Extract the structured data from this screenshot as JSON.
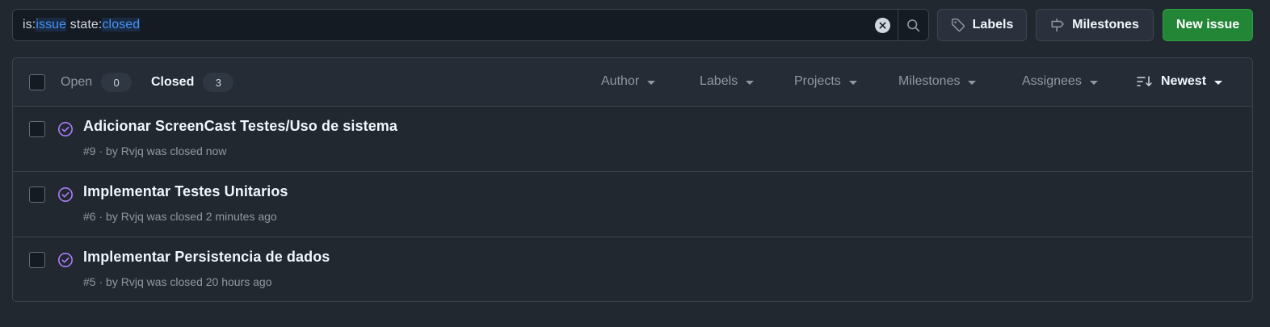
{
  "search": {
    "prefix_is": "is:",
    "value_is": "issue",
    "prefix_state": " state:",
    "value_state": "closed"
  },
  "toolbar": {
    "labels_label": "Labels",
    "milestones_label": "Milestones",
    "new_issue_label": "New issue"
  },
  "states": {
    "open_label": "Open",
    "open_count": "0",
    "closed_label": "Closed",
    "closed_count": "3"
  },
  "filters": {
    "author": "Author",
    "labels": "Labels",
    "projects": "Projects",
    "milestones": "Milestones",
    "assignees": "Assignees",
    "sort": "Newest"
  },
  "issues": [
    {
      "title": "Adicionar ScreenCast Testes/Uso de sistema",
      "number": "#9",
      "by": "by",
      "author": "Rvjq",
      "status": "was closed now"
    },
    {
      "title": "Implementar Testes Unitarios",
      "number": "#6",
      "by": "by",
      "author": "Rvjq",
      "status": "was closed 2 minutes ago"
    },
    {
      "title": "Implementar Persistencia de dados",
      "number": "#5",
      "by": "by",
      "author": "Rvjq",
      "status": "was closed 20 hours ago"
    }
  ],
  "colors": {
    "accent": "#4493f8",
    "closed_icon": "#ab7df8",
    "new_button": "#238636"
  }
}
